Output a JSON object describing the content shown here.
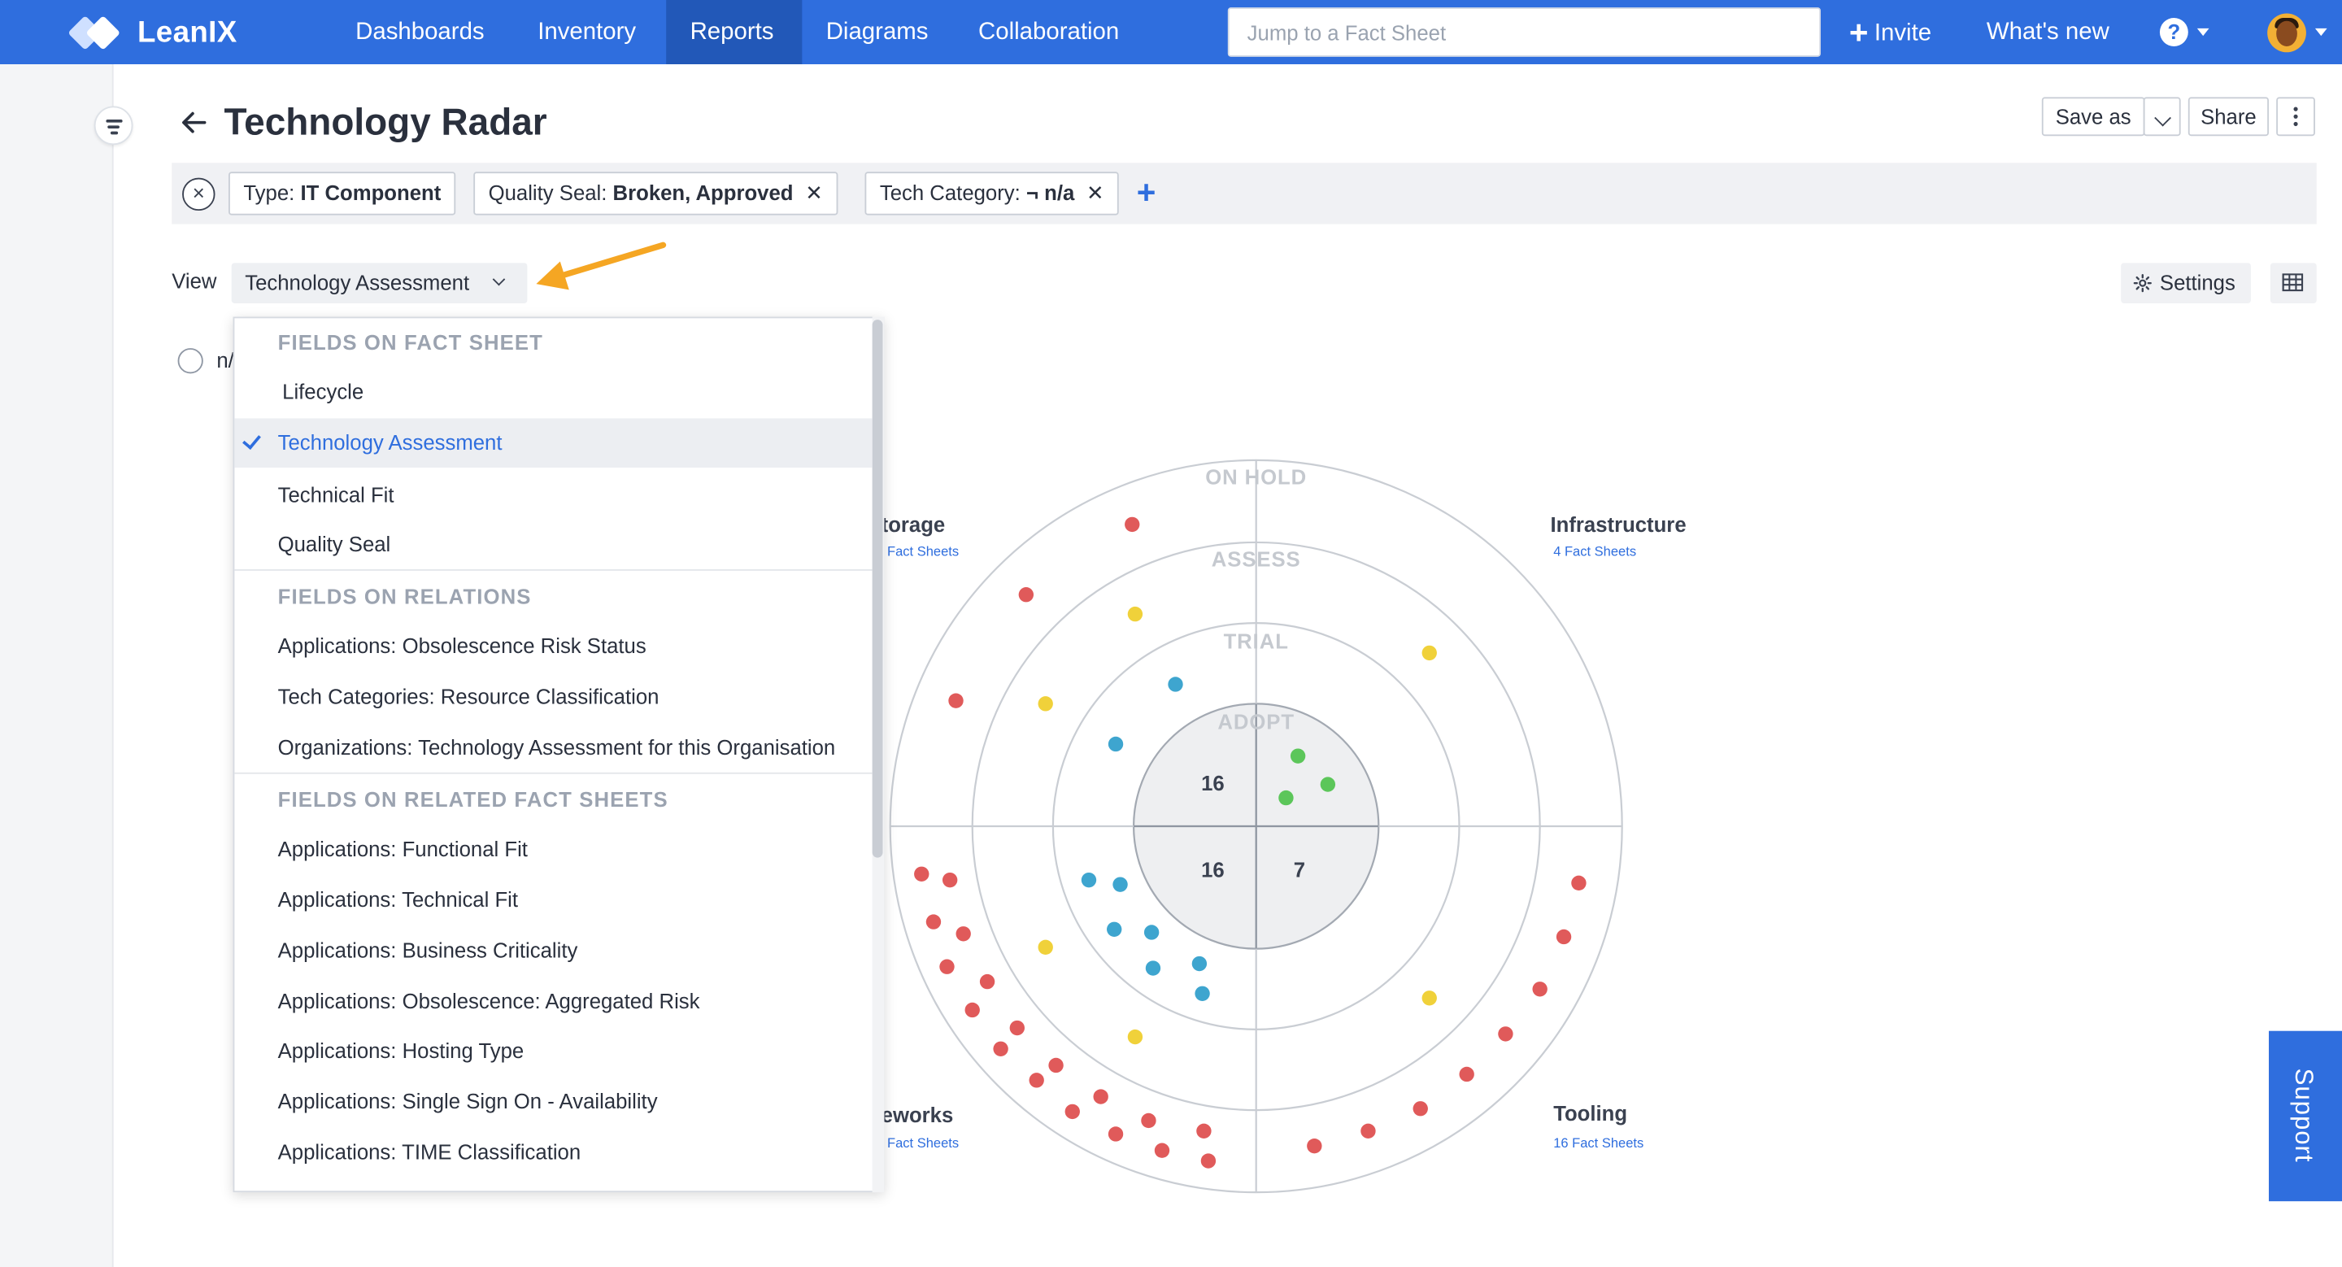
{
  "app": {
    "brand": "LeanIX"
  },
  "nav": {
    "items": [
      {
        "label": "Dashboards",
        "active": false
      },
      {
        "label": "Inventory",
        "active": false
      },
      {
        "label": "Reports",
        "active": true
      },
      {
        "label": "Diagrams",
        "active": false
      },
      {
        "label": "Collaboration",
        "active": false
      }
    ],
    "search_placeholder": "Jump to a Fact Sheet",
    "invite_label": "Invite",
    "whats_new_label": "What's new",
    "help_label": "?"
  },
  "header": {
    "title": "Technology Radar",
    "save_as_label": "Save as",
    "share_label": "Share"
  },
  "filters": {
    "chips": [
      {
        "key": "Type: ",
        "value": "IT Component",
        "removable": false
      },
      {
        "key": "Quality Seal: ",
        "value": "Broken, Approved",
        "removable": true
      },
      {
        "key": "Tech Category: ",
        "value": "¬ n/a",
        "removable": true
      }
    ],
    "add_label": "+"
  },
  "view": {
    "label": "View",
    "selected": "Technology Assessment",
    "settings_label": "Settings"
  },
  "legend_radio_label": "n/",
  "support_label": "Support",
  "dropdown": {
    "groups": [
      {
        "title": "FIELDS ON FACT SHEET",
        "items": [
          "Lifecycle",
          "Technology Assessment",
          "Technical Fit",
          "Quality Seal"
        ]
      },
      {
        "title": "FIELDS ON RELATIONS",
        "items": [
          "Applications: Obsolescence Risk Status",
          "Tech Categories: Resource Classification",
          "Organizations: Technology Assessment for this Organisation"
        ]
      },
      {
        "title": "FIELDS ON RELATED FACT SHEETS",
        "items": [
          "Applications: Functional Fit",
          "Applications: Technical Fit",
          "Applications: Business Criticality",
          "Applications: Obsolescence: Aggregated Risk",
          "Applications: Hosting Type",
          "Applications: Single Sign On - Availability",
          "Applications: TIME Classification"
        ]
      }
    ],
    "selected_item": "Technology Assessment"
  },
  "radar": {
    "rings": [
      "ON HOLD",
      "ASSESS",
      "TRIAL",
      "ADOPT"
    ],
    "quadrants": [
      {
        "name": "torage",
        "subtitle": "Fact Sheets"
      },
      {
        "name": "Infrastructure",
        "subtitle": "4 Fact Sheets"
      },
      {
        "name": "eworks",
        "subtitle": "Fact Sheets"
      },
      {
        "name": "Tooling",
        "subtitle": "16 Fact Sheets"
      }
    ],
    "center_counts": [
      "16",
      "16",
      "7"
    ],
    "colors": {
      "on_hold": "#e05a5a",
      "assess": "#f0d13a",
      "trial": "#3ea5cf",
      "adopt": "#5cc65a",
      "grid": "#c9cdd3",
      "center_fill": "#eeeff1"
    }
  }
}
